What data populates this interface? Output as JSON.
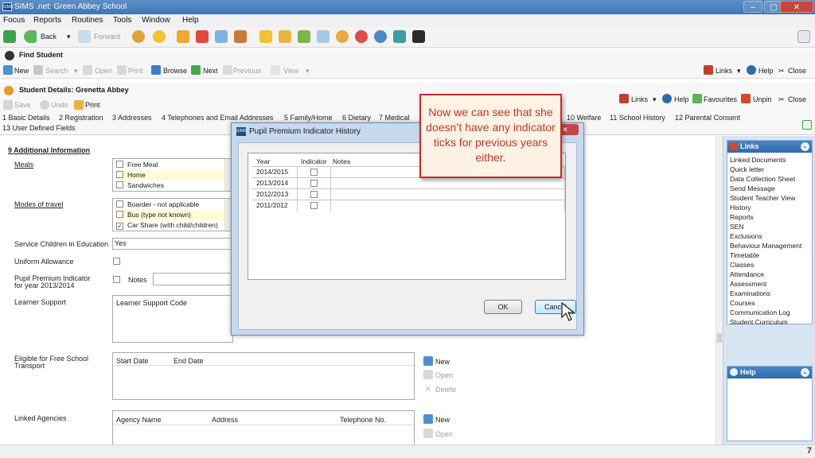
{
  "window": {
    "title": "SIMS .net: Green Abbey School",
    "app_badge": "SIMS",
    "controls": [
      "–",
      "▢",
      "✕"
    ]
  },
  "menu": [
    "Focus",
    "Reports",
    "Routines",
    "Tools",
    "Window",
    "Help"
  ],
  "nav": {
    "back": "Back",
    "forward": "Forward"
  },
  "find_student": {
    "title": "Find Student",
    "tools": [
      "New",
      "Search",
      "Open",
      "Print",
      "Browse",
      "Next",
      "Previous",
      "View"
    ],
    "links": "Links",
    "help": "Help",
    "close": "Close"
  },
  "student_details": {
    "title": "Student Details: Grenetta Abbey",
    "tools": {
      "save": "Save",
      "undo": "Undo",
      "print": "Print"
    },
    "right_tools": {
      "links": "Links",
      "help": "Help",
      "favourites": "Favourites",
      "unpin": "Unpin",
      "close": "Close"
    },
    "tabs_row1": [
      "1 Basic Details",
      "2 Registration",
      "3 Addresses",
      "4 Telephones and Email Addresses",
      "5 Family/Home",
      "6 Dietary",
      "7 Medical",
      "10 Welfare",
      "11 School History",
      "12 Parental Consent"
    ],
    "tabs_row2": [
      "13 User Defined Fields"
    ]
  },
  "section": {
    "title": "9 Additional Information",
    "meals_label": "Meals",
    "meals_options": [
      "Free Meal",
      "Home",
      "Sandwiches"
    ],
    "travel_label": "Modes of travel",
    "travel_options": [
      "Boarder - not applicable",
      "Bus (type not known)",
      "Car Share (with child/children)"
    ],
    "travel_checked_mark": "✓",
    "service_children_label": "Service Children in Education",
    "service_children_value": "Yes",
    "uniform_label": "Uniform Allowance",
    "pupil_premium_label_1": "Pupil Premium Indicator",
    "pupil_premium_label_2": "for year 2013/2014",
    "notes_label": "Notes",
    "learner_support_label": "Learner Support",
    "learner_support_col": "Learner Support Code",
    "transport_label_1": "Eligible for Free School",
    "transport_label_2": "Transport",
    "transport_cols": [
      "Start Date",
      "End Date"
    ],
    "transport_actions": [
      "New",
      "Open",
      "Delete"
    ],
    "agencies_label": "Linked Agencies",
    "agencies_cols": [
      "Agency Name",
      "Address",
      "Telephone No."
    ],
    "agencies_actions": [
      "New",
      "Open"
    ]
  },
  "links_panel": {
    "title": "Links",
    "items": [
      "Linked Documents",
      "Quick letter",
      "Data Collection Sheet",
      "Send Message",
      "Student Teacher View",
      "History",
      "Reports",
      "SEN",
      "Exclusions",
      "Behaviour Management",
      "Timetable",
      "Classes",
      "Attendance",
      "Assessment",
      "Examinations",
      "Courses",
      "Communication Log",
      "Student Curriculum"
    ]
  },
  "help_panel": {
    "title": "Help"
  },
  "dialog": {
    "title": "Pupil Premium Indicator History",
    "columns": [
      "Year",
      "Indicator",
      "Notes"
    ],
    "rows": [
      {
        "year": "2014/2015",
        "indicator": false,
        "notes": ""
      },
      {
        "year": "2013/2014",
        "indicator": false,
        "notes": ""
      },
      {
        "year": "2012/2013",
        "indicator": false,
        "notes": ""
      },
      {
        "year": "2011/2012",
        "indicator": false,
        "notes": ""
      }
    ],
    "ok": "OK",
    "cancel": "Cancel"
  },
  "callout": {
    "text": "Now we can see that she doesn’t have any indicator ticks for previous years either."
  },
  "slide_number": "7",
  "colors": {
    "titlebar": "#3f76b3",
    "panel_head": "#2f6aac",
    "callout_border": "#cc2a2a",
    "callout_text": "#c0392b"
  }
}
